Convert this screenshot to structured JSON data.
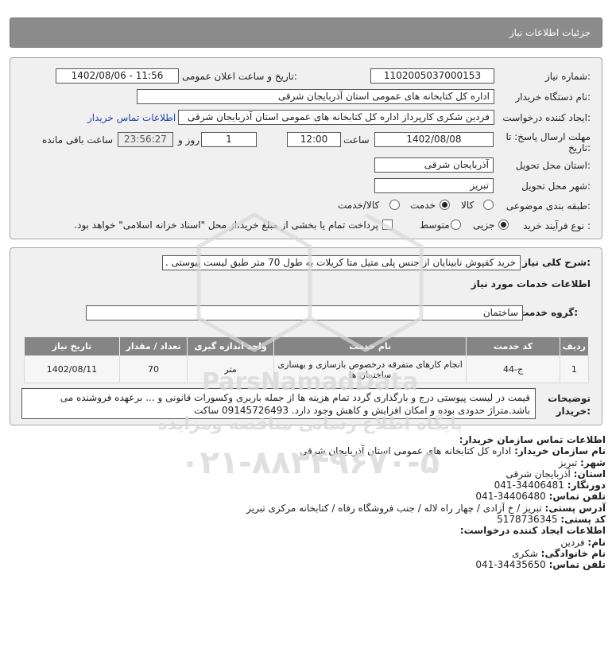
{
  "header": {
    "title": "جزئیات اطلاعات نیاز"
  },
  "form": {
    "need_number_label": "شماره نیاز:",
    "need_number": "1102005037000153",
    "announce_label": "تاریخ و ساعت اعلان عمومی:",
    "announce_value": "1402/08/06 - 11:56",
    "buyer_org_label": "نام دستگاه خریدار:",
    "buyer_org": "اداره کل کتابخانه های عمومی استان آذربایجان شرقی",
    "creator_label": "ایجاد کننده درخواست:",
    "creator": "فردین شکری کارپرداز اداره کل کتابخانه های عمومی استان آذربایجان شرقی",
    "contact_link": "اطلاعات تماس خریدار",
    "deadline_label_1": "مهلت ارسال پاسخ: تا",
    "deadline_label_2": "تاریخ:",
    "deadline_date": "1402/08/08",
    "time_label": "ساعت",
    "deadline_time": "12:00",
    "days_value": "1",
    "days_label": "روز و",
    "remaining_time": "23:56:27",
    "remaining_label": "ساعت باقی مانده",
    "province_label": "استان محل تحویل:",
    "province": "آذربایجان شرقی",
    "city_label": "شهر محل تحویل:",
    "city": "تبریز",
    "category_label": "طبقه بندی موضوعی:",
    "category_options": [
      "کالا",
      "خدمت",
      "کالا/خدمت"
    ],
    "category_selected": 1,
    "process_label": "نوع فرآیند خرید :",
    "process_options": [
      "جزیی",
      "متوسط"
    ],
    "process_selected": 0,
    "payment_text": "پرداخت تمام یا بخشی از مبلغ خرید،از محل \"اسناد خزانه اسلامی\" خواهد بود."
  },
  "details": {
    "summary_label": "شرح کلی نیاز:",
    "summary": "خرید کفپوش نابینایان از جنس پلی متیل متا کریلات به طول 70 متر طبق لیست پیوستی .",
    "services_title": "اطلاعات خدمات مورد نیاز",
    "group_label": "گروه خدمت:",
    "group": "ساختمان",
    "table": {
      "headers": [
        "ردیف",
        "کد خدمت",
        "نام خدمت",
        "واحد اندازه گیری",
        "تعداد / مقدار",
        "تاریخ نیاز"
      ],
      "rows": [
        {
          "row": "1",
          "code": "ج-44",
          "name": "انجام کارهای متفرقه درخصوص بازسازی و بهسازی ساختمان ها",
          "unit": "متر",
          "qty": "70",
          "date": "1402/08/11"
        }
      ]
    },
    "notes_label_1": "توضیحات",
    "notes_label_2": "خریدار:",
    "notes": "قیمت در لیست پیوستی درج و بارگذاری گردد تمام هزینه ها از جمله باربری وکسورات قانونی و ... برعهده فروشنده می باشد.متراژ حدودی بوده و امکان افزایش و کاهش وجود دارد. 09145726493 ساکت"
  },
  "contact": {
    "title": "اطلاعات تماس سازمان خریدار:",
    "org_label": "نام سازمان خریدار:",
    "org": "اداره کل کتابخانه های عمومی استان آذربایجان شرقی",
    "city_label": "شهر:",
    "city": "تبریز",
    "province_label": "استان:",
    "province": "آذربایجان شرقی",
    "fax_label": "دورنگار:",
    "fax": "041-34406481",
    "phone_label": "تلفن تماس:",
    "phone": "041-34406480",
    "address_label": "آدرس پستی:",
    "address": "تبریز / خ آزادی / چهار راه لاله / جنب فروشگاه رفاه / کتابخانه مرکزی تبریز",
    "postal_label": "کد پستی:",
    "postal": "5178736345",
    "creator_title": "اطلاعات ایجاد کننده درخواست:",
    "first_name_label": "نام:",
    "first_name": "فردین",
    "last_name_label": "نام خانوادگی:",
    "last_name": "شکری",
    "creator_phone_label": "تلفن تماس:",
    "creator_phone": "041-34435650"
  },
  "watermark": {
    "lines": [
      "ParsNamadData",
      "پایگاه اطلاع رسانی مناقصه ومزایده",
      "۰۲۱-۸۸۳۴۹۶۷۰-۵"
    ],
    "color": "#d9d9d9"
  }
}
